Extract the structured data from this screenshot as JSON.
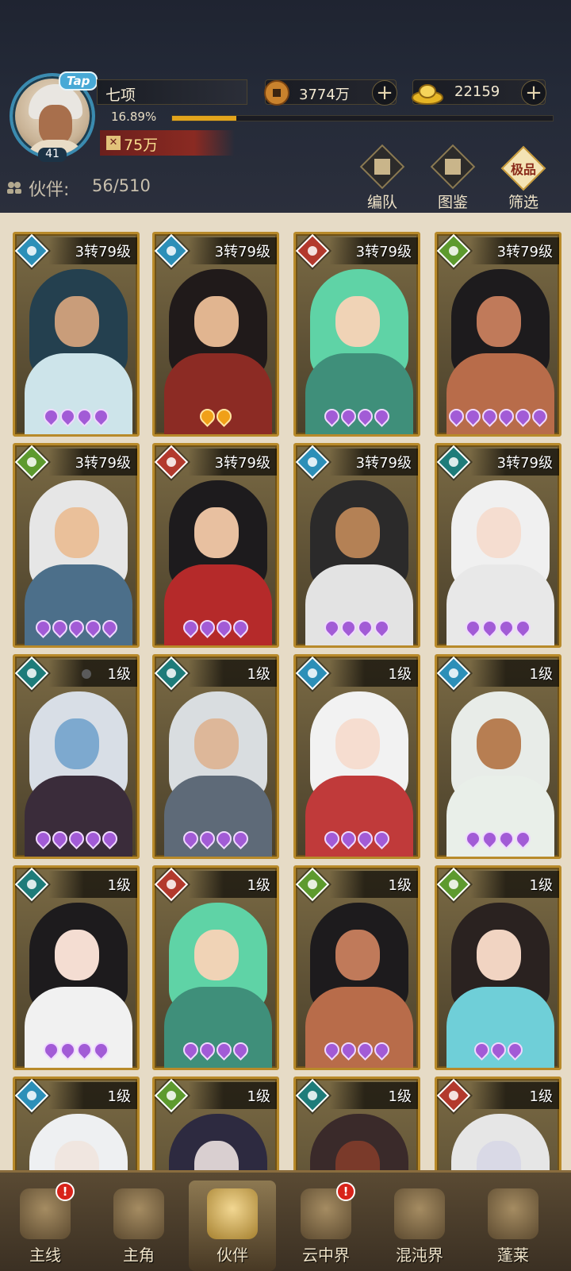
{
  "player": {
    "name": "七项",
    "level": "41",
    "tap_label": "Tap",
    "exp_percent": "16.89%",
    "exp_fraction": 0.1689,
    "power": "75万"
  },
  "currency": {
    "coins": "3774万",
    "gold": "22159"
  },
  "partners": {
    "label": "伙伴:",
    "count": "56/510"
  },
  "tools": {
    "team": "编队",
    "gallery": "图鉴",
    "filter": "筛选",
    "filter_tag": "极品"
  },
  "cards": [
    {
      "level": "3转79级",
      "element": "water",
      "stars": 4,
      "star_color": "purple",
      "palette": [
        "#24404f",
        "#c99d7a",
        "#cde4ea"
      ]
    },
    {
      "level": "3转79级",
      "element": "water",
      "stars": 2,
      "star_color": "gold",
      "palette": [
        "#201a1a",
        "#e1b590",
        "#8c2b24"
      ]
    },
    {
      "level": "3转79级",
      "element": "fire",
      "stars": 4,
      "star_color": "purple",
      "palette": [
        "#5fd3a6",
        "#f0d3b6",
        "#3f8f7a"
      ]
    },
    {
      "level": "3转79级",
      "element": "wood",
      "stars": 6,
      "star_color": "purple",
      "palette": [
        "#1d1b1d",
        "#c07a5a",
        "#b86c4a"
      ]
    },
    {
      "level": "3转79级",
      "element": "wood",
      "stars": 5,
      "star_color": "purple",
      "palette": [
        "#e6e6e6",
        "#eac09a",
        "#4c6f8a"
      ]
    },
    {
      "level": "3转79级",
      "element": "fire",
      "stars": 4,
      "star_color": "purple",
      "palette": [
        "#1d1b1d",
        "#e8c0a0",
        "#b52a2a"
      ]
    },
    {
      "level": "3转79级",
      "element": "water",
      "stars": 4,
      "star_color": "purple",
      "palette": [
        "#2b2a2a",
        "#b48155",
        "#e3e3e3"
      ]
    },
    {
      "level": "3转79级",
      "element": "dark",
      "stars": 4,
      "star_color": "purple",
      "palette": [
        "#f0f0f0",
        "#f5ddd0",
        "#e8e8e8"
      ]
    },
    {
      "level": "1级",
      "element": "dark",
      "stars": 5,
      "star_color": "purple",
      "palette": [
        "#d8dee6",
        "#7da9cf",
        "#3a2c3a"
      ],
      "has_dot": true
    },
    {
      "level": "1级",
      "element": "dark",
      "stars": 4,
      "star_color": "purple",
      "palette": [
        "#d9dde0",
        "#ddb799",
        "#5e6a78"
      ]
    },
    {
      "level": "1级",
      "element": "water",
      "stars": 4,
      "star_color": "purple",
      "palette": [
        "#f2f2f2",
        "#f6ddd0",
        "#c03a3a"
      ]
    },
    {
      "level": "1级",
      "element": "water",
      "stars": 4,
      "star_color": "purple",
      "palette": [
        "#e8ece8",
        "#b77e52",
        "#e9efe9"
      ]
    },
    {
      "level": "1级",
      "element": "dark",
      "stars": 4,
      "star_color": "purple",
      "palette": [
        "#1d1b1d",
        "#f4ddd2",
        "#f1f1f1"
      ]
    },
    {
      "level": "1级",
      "element": "fire",
      "stars": 4,
      "star_color": "purple",
      "palette": [
        "#5fd3a6",
        "#f0d3b6",
        "#3f8f7a"
      ]
    },
    {
      "level": "1级",
      "element": "wood",
      "stars": 4,
      "star_color": "purple",
      "palette": [
        "#1d1b1d",
        "#c07a5a",
        "#b86c4a"
      ]
    },
    {
      "level": "1级",
      "element": "wood",
      "stars": 3,
      "star_color": "purple",
      "palette": [
        "#2a2220",
        "#f1d4c2",
        "#6fcfd8"
      ]
    },
    {
      "level": "1级",
      "element": "water",
      "stars": 0,
      "star_color": "purple",
      "palette": [
        "#eef0f2",
        "#f0e6e0",
        "#e6e6e6"
      ]
    },
    {
      "level": "1级",
      "element": "wood",
      "stars": 0,
      "star_color": "purple",
      "palette": [
        "#2d2a40",
        "#d9cfd0",
        "#3c3a58"
      ]
    },
    {
      "level": "1级",
      "element": "dark",
      "stars": 0,
      "star_color": "purple",
      "palette": [
        "#3a2a2a",
        "#7a3a2a",
        "#5a2a2a"
      ]
    },
    {
      "level": "1级",
      "element": "fire",
      "stars": 0,
      "star_color": "purple",
      "palette": [
        "#e6e6e6",
        "#d9d9e6",
        "#bdbdcd"
      ]
    }
  ],
  "nav": [
    {
      "label": "主线",
      "alert": "!",
      "icon": "crossed-swords-icon"
    },
    {
      "label": "主角",
      "alert": "",
      "icon": "hero-icon"
    },
    {
      "label": "伙伴",
      "alert": "",
      "icon": "partner-helmet-icon",
      "active": true
    },
    {
      "label": "云中界",
      "alert": "!",
      "icon": "pavilion-icon"
    },
    {
      "label": "混沌界",
      "alert": "",
      "icon": "tower-icon"
    },
    {
      "label": "蓬莱",
      "alert": "",
      "icon": "sage-icon"
    }
  ],
  "colors": {
    "accent_gold": "#e2a41c",
    "card_border": "#b88a2a",
    "star_purple": "#a25bd6"
  }
}
